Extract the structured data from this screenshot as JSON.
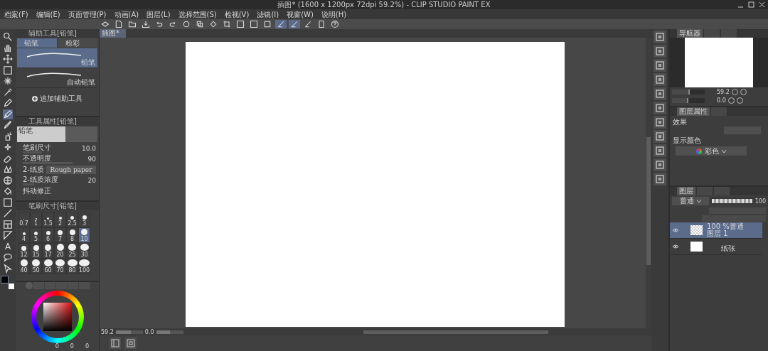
{
  "window": {
    "title": "插图* (1600 x 1200px 72dpi 59.2%) - CLIP STUDIO PAINT EX"
  },
  "menu": [
    "档案(F)",
    "编辑(E)",
    "页面管理(P)",
    "动画(A)",
    "图层(L)",
    "选择范围(S)",
    "检视(V)",
    "滤镜(I)",
    "视窗(W)",
    "说明(H)"
  ],
  "tool_glyph": "A",
  "sub_tool": {
    "title": "辅助工具[铅笔]",
    "groups": [
      {
        "label": "铅笔",
        "selected": true
      },
      {
        "label": "粉彩",
        "selected": false
      }
    ],
    "items": [
      {
        "label": "铅笔",
        "selected": true
      },
      {
        "label": "自动铅笔",
        "selected": false
      }
    ],
    "add_label": "追加辅助工具"
  },
  "tool_property": {
    "title": "工具属性[铅笔]",
    "preview_label": "铅笔",
    "rows": [
      {
        "kind": "slider",
        "label": "笔刷尺寸",
        "value": "10.0",
        "level": 0.35
      },
      {
        "kind": "slider",
        "label": "不透明度",
        "value": "90",
        "level": 0.9
      },
      {
        "kind": "texture",
        "label": "2-纸质",
        "value": "Rough paper"
      },
      {
        "kind": "slider",
        "label": "2-纸质浓度",
        "value": "20",
        "level": 0.2
      },
      {
        "kind": "label",
        "label": "抖动修正"
      }
    ]
  },
  "brush_size": {
    "title": "笔刷尺寸[铅笔]",
    "sizes": [
      {
        "label": "0.7",
        "selected": false
      },
      {
        "label": "1",
        "selected": false
      },
      {
        "label": "1.5",
        "selected": false
      },
      {
        "label": "2",
        "selected": false
      },
      {
        "label": "2.5",
        "selected": false
      },
      {
        "label": "3",
        "selected": false
      },
      {
        "label": "4",
        "selected": false
      },
      {
        "label": "5",
        "selected": false
      },
      {
        "label": "6",
        "selected": false
      },
      {
        "label": "7",
        "selected": false
      },
      {
        "label": "8",
        "selected": false
      },
      {
        "label": "10",
        "selected": true
      },
      {
        "label": "12",
        "selected": false
      },
      {
        "label": "15",
        "selected": false
      },
      {
        "label": "17",
        "selected": false
      },
      {
        "label": "20",
        "selected": false
      },
      {
        "label": "25",
        "selected": false
      },
      {
        "label": "30",
        "selected": false
      },
      {
        "label": "40",
        "selected": false
      },
      {
        "label": "50",
        "selected": false
      },
      {
        "label": "60",
        "selected": false
      },
      {
        "label": "70",
        "selected": false
      },
      {
        "label": "80",
        "selected": false
      },
      {
        "label": "100",
        "selected": false
      }
    ]
  },
  "color": {
    "values": [
      "0",
      "0",
      "0"
    ]
  },
  "canvas_tab": {
    "label": "插图*"
  },
  "status": {
    "zoom": "59.2",
    "zoom_slider": {
      "level": 0.55
    },
    "angle": "0.0",
    "rotation_slider": {
      "level": 0.5
    }
  },
  "navigator": {
    "tab": "导航器",
    "zoom": "59.2",
    "zoom_slider": {
      "level": 0.55
    },
    "angle": "0.0",
    "rotation_slider": {
      "level": 0.5
    }
  },
  "layer_property": {
    "tab": "图层属性",
    "effect_label": "效果",
    "display_color_label": "显示颜色",
    "display_color": "彩色"
  },
  "layers": {
    "tab": "图层",
    "blend_mode": "普通",
    "opacity": "100",
    "opacity_slider": {
      "level": 1
    },
    "rows": [
      {
        "kind": "raster",
        "mode": "100 %普通",
        "name": "图层 1",
        "selected": true
      },
      {
        "kind": "paper",
        "name": "纸张",
        "selected": false
      }
    ]
  }
}
